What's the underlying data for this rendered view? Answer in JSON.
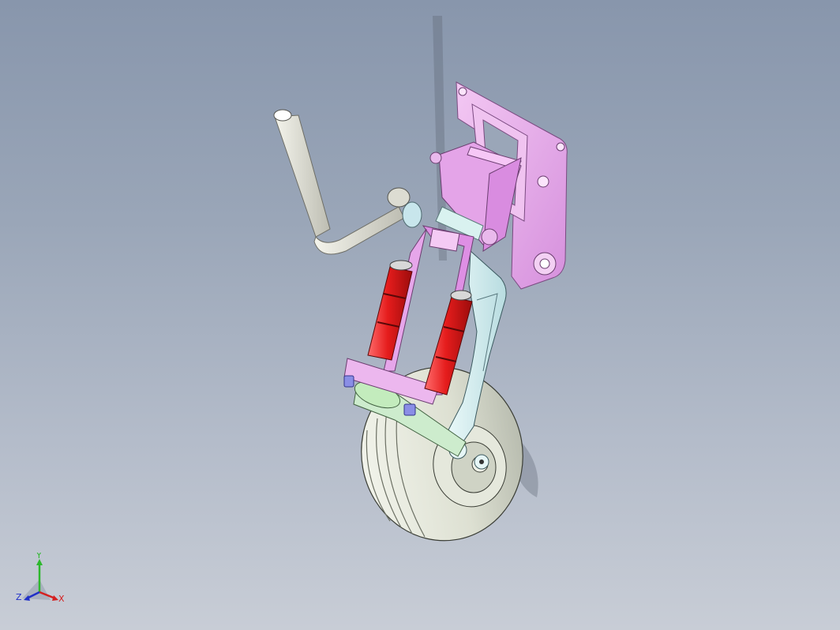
{
  "viewport": {
    "background_top": "#8896ac",
    "background_bottom": "#c8cdd6"
  },
  "model": {
    "parts": [
      {
        "name": "mounting-plate",
        "color": "#e7a9e6"
      },
      {
        "name": "hinge-bracket",
        "color": "#d07fd8"
      },
      {
        "name": "shock-absorber",
        "color": "#e21818"
      },
      {
        "name": "trailing-arm",
        "color": "#d9f1f3"
      },
      {
        "name": "axle-link",
        "color": "#bfe8bf"
      },
      {
        "name": "wheel-tire",
        "color": "#e8ebdf"
      },
      {
        "name": "tow-handle",
        "color": "#e6e6dc"
      },
      {
        "name": "pivot-bushing",
        "color": "#8a8ee6"
      }
    ]
  },
  "triad": {
    "y_label": "Y",
    "x_label": "X",
    "z_label": "Z",
    "y_color": "#2db82d",
    "x_color": "#d42020",
    "z_color": "#2030c8"
  }
}
